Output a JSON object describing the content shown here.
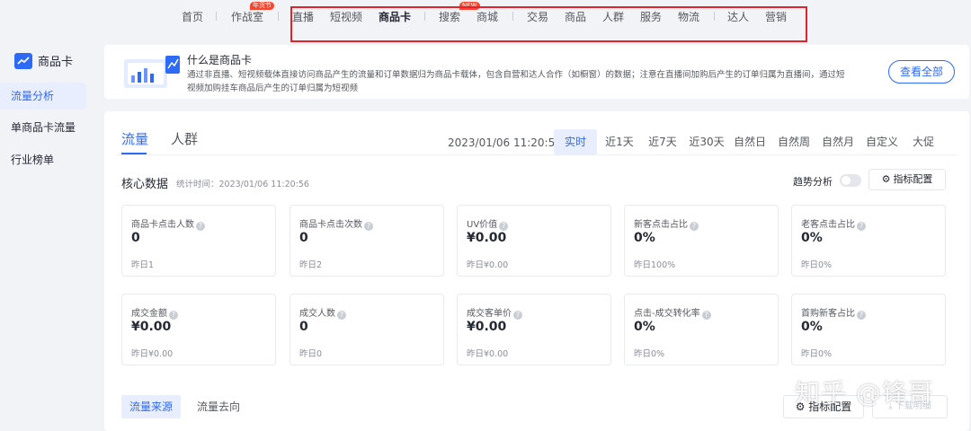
{
  "topnav": {
    "items": [
      "首页",
      "作战室",
      "直播",
      "短视频",
      "商品卡",
      "搜索",
      "商城",
      "交易",
      "商品",
      "人群",
      "服务",
      "物流",
      "达人",
      "营销"
    ],
    "badges": {
      "war_room": "年货节",
      "search": "NEW"
    },
    "highlight_color": "#e8202a"
  },
  "sidebar": {
    "header_label": "商品卡",
    "header_icon": "trend-chart-icon",
    "items": [
      "流量分析",
      "单商品卡流量",
      "行业榜单"
    ]
  },
  "banner": {
    "title": "什么是商品卡",
    "description": "通过非直播、短视频载体直接访问商品产生的流量和订单数据归为商品卡载体，包含自营和达人合作（如橱窗）的数据；注意在直播间加购后产生的订单归属为直播间，通过短视频加购挂车商品后产生的订单归属为短视频",
    "button_label": "查看全部"
  },
  "main": {
    "tabs": [
      "流量",
      "人群"
    ],
    "datetime": "2023/01/06 11:20:56",
    "ranges": [
      "实时",
      "近1天",
      "近7天",
      "近30天",
      "自然日",
      "自然周",
      "自然月",
      "自定义",
      "大促"
    ],
    "core_title": "核心数据",
    "core_time": "统计时间：2023/01/06 11:20:56",
    "trend_label": "趋势分析",
    "config_label": "指标配置",
    "metrics": [
      {
        "label": "商品卡点击人数",
        "value": "0",
        "yesterday": "昨日1"
      },
      {
        "label": "商品卡点击次数",
        "value": "0",
        "yesterday": "昨日2"
      },
      {
        "label": "UV价值",
        "value": "¥0.00",
        "yesterday": "昨日¥0.00"
      },
      {
        "label": "新客点击占比",
        "value": "0%",
        "yesterday": "昨日100%"
      },
      {
        "label": "老客点击占比",
        "value": "0%",
        "yesterday": "昨日0%"
      },
      {
        "label": "成交金额",
        "value": "¥0.00",
        "yesterday": "昨日¥0.00"
      },
      {
        "label": "成交人数",
        "value": "0",
        "yesterday": "昨日0"
      },
      {
        "label": "成交客单价",
        "value": "¥0.00",
        "yesterday": "昨日¥0.00"
      },
      {
        "label": "点击-成交转化率",
        "value": "0%",
        "yesterday": "昨日0%"
      },
      {
        "label": "首购新客占比",
        "value": "0%",
        "yesterday": "昨日0%"
      }
    ],
    "subtabs": [
      "流量来源",
      "流量去向"
    ],
    "config_label2": "指标配置",
    "download_label": "下载明细"
  },
  "watermark": "知乎 @锋哥",
  "colors": {
    "accent": "#2d6af6",
    "background": "#f2f3f7"
  }
}
